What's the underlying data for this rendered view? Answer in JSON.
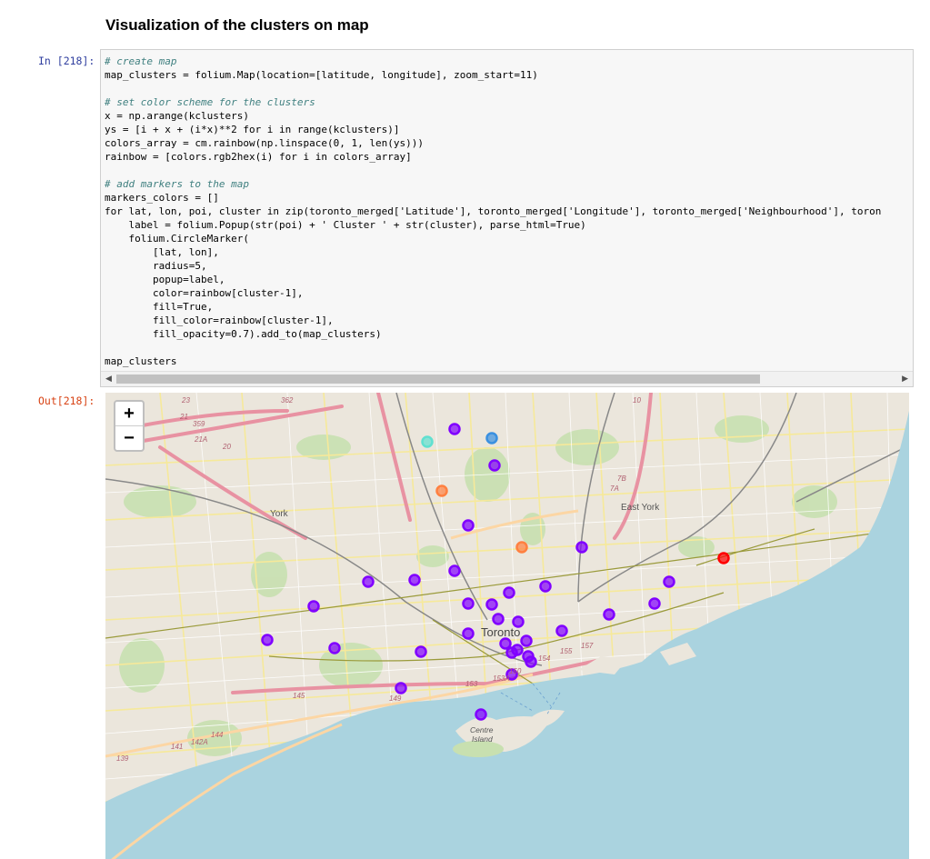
{
  "section_heading": "Visualization of the clusters on map",
  "input_prompt": "In [218]:",
  "output_prompt": "Out[218]:",
  "code_lines": [
    "# create map",
    "map_clusters = folium.Map(location=[latitude, longitude], zoom_start=11)",
    "",
    "# set color scheme for the clusters",
    "x = np.arange(kclusters)",
    "ys = [i + x + (i*x)**2 for i in range(kclusters)]",
    "colors_array = cm.rainbow(np.linspace(0, 1, len(ys)))",
    "rainbow = [colors.rgb2hex(i) for i in colors_array]",
    "",
    "# add markers to the map",
    "markers_colors = []",
    "for lat, lon, poi, cluster in zip(toronto_merged['Latitude'], toronto_merged['Longitude'], toronto_merged['Neighbourhood'], toron",
    "    label = folium.Popup(str(poi) + ' Cluster ' + str(cluster), parse_html=True)",
    "    folium.CircleMarker(",
    "        [lat, lon],",
    "        radius=5,",
    "        popup=label,",
    "        color=rainbow[cluster-1],",
    "        fill=True,",
    "        fill_color=rainbow[cluster-1],",
    "        fill_opacity=0.7).add_to(map_clusters)",
    "",
    "map_clusters"
  ],
  "map": {
    "zoom_in": "+",
    "zoom_out": "−",
    "place_labels": {
      "toronto": "Toronto",
      "east_york": "East York",
      "york": "York",
      "centre_island_1": "Centre",
      "centre_island_2": "Island"
    },
    "route_labels": [
      "23",
      "362",
      "359",
      "21",
      "21A",
      "20",
      "7B",
      "7A",
      "10",
      "145",
      "149",
      "153",
      "154",
      "155",
      "157",
      "141",
      "142A",
      "144",
      "139",
      "153A",
      "150"
    ],
    "cluster_colors": {
      "cluster_purple": "#8000ff",
      "cluster_cyan": "#60e0d0",
      "cluster_blue": "#3a90e0",
      "cluster_orange": "#ff8040",
      "cluster_red": "#ff0000"
    }
  }
}
